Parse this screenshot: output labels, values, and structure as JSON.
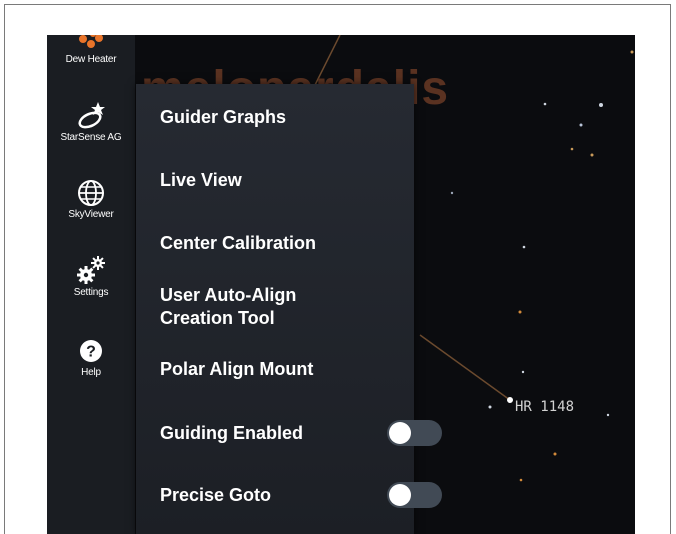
{
  "sidebar": {
    "items": [
      {
        "label": "Dew Heater",
        "icon": "dew-heater-icon"
      },
      {
        "label": "StarSense AG",
        "icon": "starsense-icon"
      },
      {
        "label": "SkyViewer",
        "icon": "globe-icon"
      },
      {
        "label": "Settings",
        "icon": "gears-icon"
      },
      {
        "label": "Help",
        "icon": "help-icon"
      }
    ]
  },
  "menu": {
    "items": [
      {
        "label": "Guider Graphs"
      },
      {
        "label": "Live View"
      },
      {
        "label": "Center Calibration"
      },
      {
        "label": "User Auto-Align",
        "label_line2": "Creation Tool"
      },
      {
        "label": "Polar Align Mount"
      }
    ],
    "toggles": [
      {
        "label": "Guiding Enabled",
        "on": false
      },
      {
        "label": "Precise Goto",
        "on": false
      }
    ]
  },
  "skymap": {
    "constellation_name": "melopardalis",
    "star_label": "HR 1148"
  },
  "colors": {
    "sidebar_bg": "#1a1d22",
    "menu_bg": "#23272e",
    "sky_bg": "#0b0c0f",
    "constellation_line": "#6b4a2e",
    "toggle_off": "#414a55"
  }
}
